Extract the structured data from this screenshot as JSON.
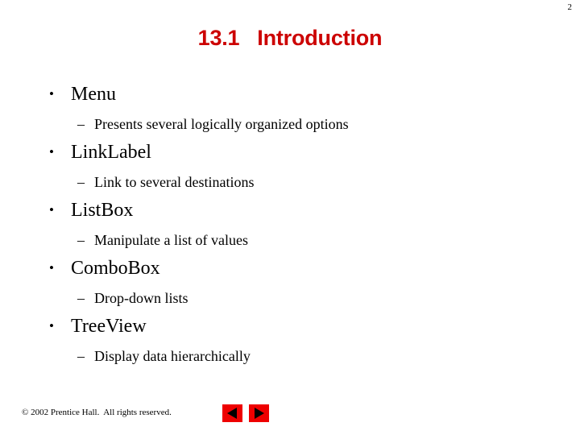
{
  "slide": {
    "page_number": "2",
    "title": "13.1   Introduction",
    "title_color": "#cc0000",
    "background_color": "#ffffff",
    "bullet_marker": "•",
    "sub_bullet_marker": "–",
    "items": [
      {
        "label": "Menu",
        "sub": "Presents several logically organized options"
      },
      {
        "label": "LinkLabel",
        "sub": "Link to several destinations"
      },
      {
        "label": "ListBox",
        "sub": "Manipulate a list of values"
      },
      {
        "label": "ComboBox",
        "sub": "Drop-down lists"
      },
      {
        "label": "TreeView",
        "sub": "Display data hierarchically"
      }
    ]
  },
  "footer": {
    "copyright": "© 2002 Prentice Hall.  All rights reserved.",
    "nav": {
      "previous_label": "previous-slide",
      "next_label": "next-slide",
      "button_color": "#ee0000",
      "arrow_color": "#000000"
    }
  }
}
